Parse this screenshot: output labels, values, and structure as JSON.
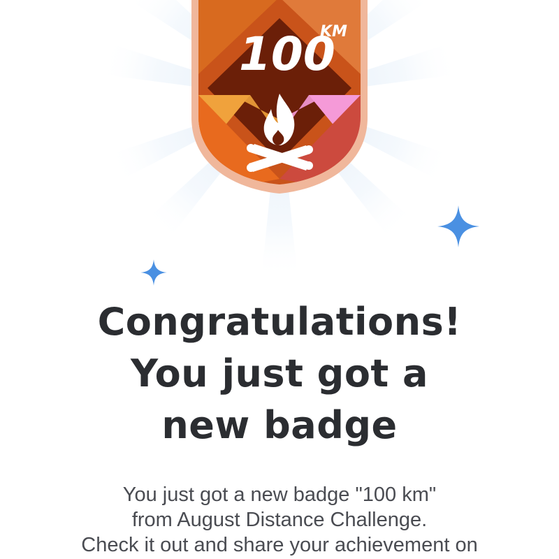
{
  "badge": {
    "value": "100",
    "unit": "KM",
    "icon": "campfire-icon"
  },
  "sparkles": [
    "sparkle-icon",
    "sparkle-icon"
  ],
  "headline": {
    "lines": [
      "Congratulations!",
      "You just got a",
      "new badge"
    ]
  },
  "message": {
    "lines": [
      "You just got a new badge \"100 km\"",
      "from August Distance Challenge.",
      "Check it out and share your achievement on"
    ]
  },
  "colors": {
    "headline_text": "#2b2d31",
    "body_text": "#4a4c52",
    "sparkle": "#4a90e2",
    "badge_border": "#f0b79b",
    "badge_dark": "#6b1f08",
    "badge_orange": "#f0a23c",
    "badge_pink": "#f59ad8",
    "ray": "#e6f0fa"
  }
}
